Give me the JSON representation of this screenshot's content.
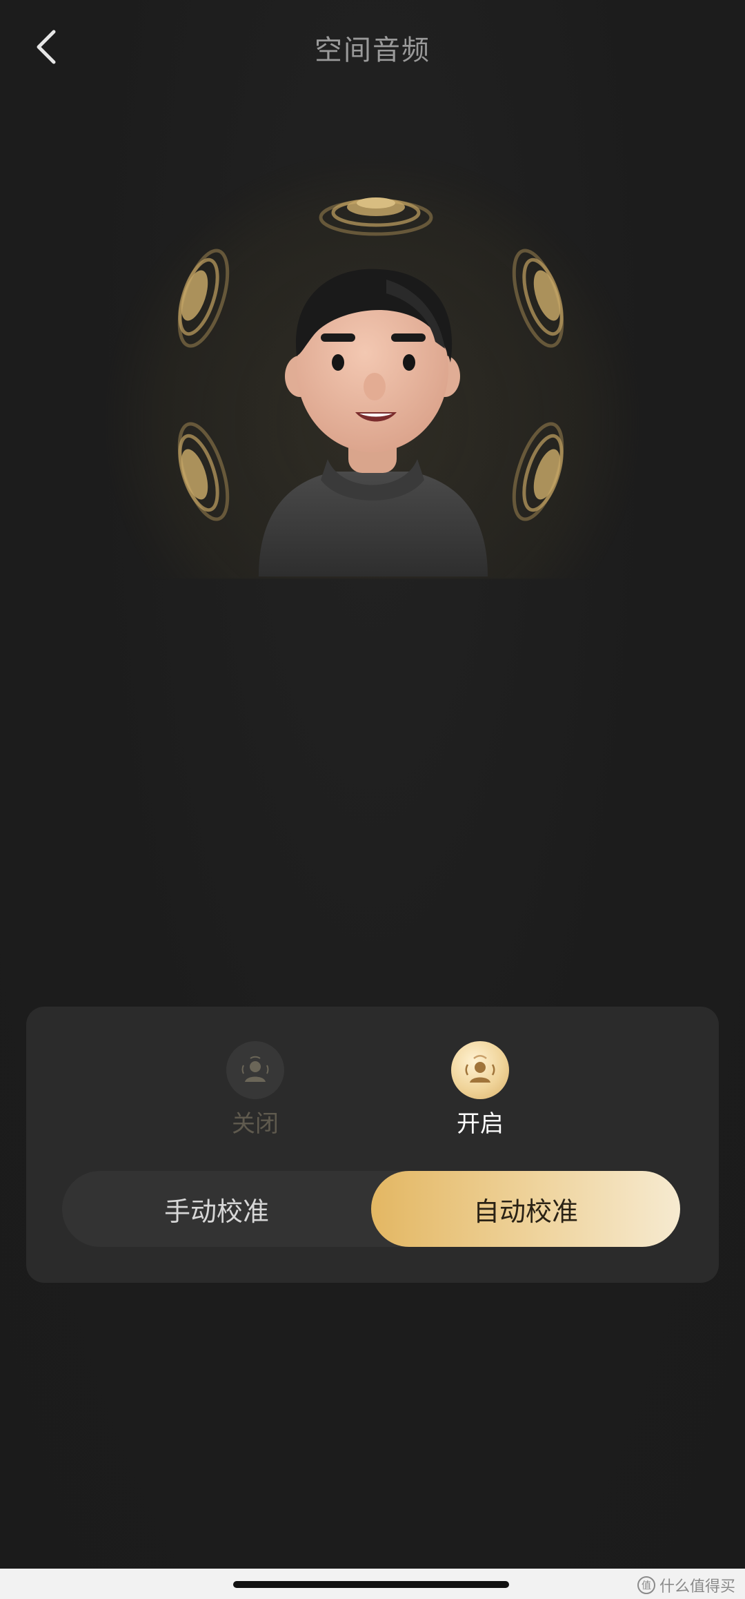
{
  "header": {
    "title": "空间音频",
    "back_icon": "chevron-left-icon"
  },
  "hero": {
    "avatar": "avatar-3d-character",
    "speaker_icon": "speaker-wave-icon"
  },
  "modes": {
    "selected": "on",
    "off": {
      "label": "关闭",
      "icon": "person-audio-icon"
    },
    "on": {
      "label": "开启",
      "icon": "person-audio-icon"
    }
  },
  "calibration": {
    "selected": "auto",
    "manual_label": "手动校准",
    "auto_label": "自动校准"
  },
  "colors": {
    "accent_gold": "#e3b763",
    "background": "#1c1c1c",
    "card": "#2b2b2b"
  },
  "watermark": {
    "text": "什么值得买"
  }
}
